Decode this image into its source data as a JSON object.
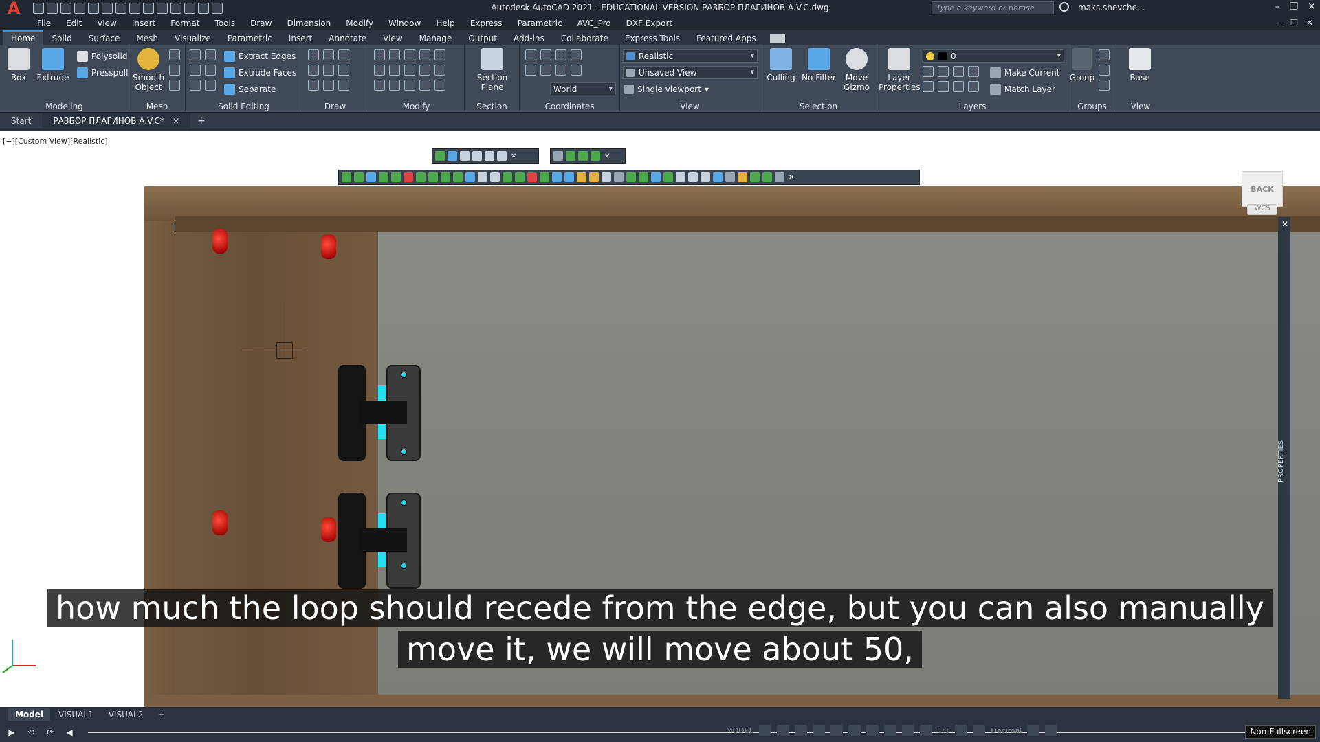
{
  "titlebar": {
    "title": "Autodesk AutoCAD 2021 - EDUCATIONAL VERSION    РАЗБОР ПЛАГИНОВ A.V.C.dwg",
    "search_placeholder": "Type a keyword or phrase",
    "user": "maks.shevche..."
  },
  "menubar": [
    "File",
    "Edit",
    "View",
    "Insert",
    "Format",
    "Tools",
    "Draw",
    "Dimension",
    "Modify",
    "Window",
    "Help",
    "Express",
    "Parametric",
    "AVC_Pro",
    "DXF Export"
  ],
  "ribbon_tabs": [
    "Home",
    "Solid",
    "Surface",
    "Mesh",
    "Visualize",
    "Parametric",
    "Insert",
    "Annotate",
    "View",
    "Manage",
    "Output",
    "Add-ins",
    "Collaborate",
    "Express Tools",
    "Featured Apps"
  ],
  "ribbon": {
    "modeling": {
      "title": "Modeling",
      "box": "Box",
      "extrude": "Extrude",
      "polysolid": "Polysolid",
      "presspull": "Presspull"
    },
    "mesh": {
      "title": "Mesh",
      "smooth_object": "Smooth Object"
    },
    "solid_editing": {
      "title": "Solid Editing",
      "extract_edges": "Extract Edges",
      "extrude_faces": "Extrude Faces",
      "separate": "Separate"
    },
    "draw": {
      "title": "Draw"
    },
    "modify": {
      "title": "Modify"
    },
    "section": {
      "title": "Section",
      "section_plane": "Section Plane"
    },
    "coordinates": {
      "title": "Coordinates",
      "world": "World"
    },
    "view": {
      "title": "View",
      "visual_style": "Realistic",
      "named_view": "Unsaved View",
      "viewport": "Single viewport"
    },
    "selection": {
      "title": "Selection",
      "culling": "Culling",
      "no_filter": "No Filter",
      "move_gizmo": "Move Gizmo"
    },
    "layers": {
      "title": "Layers",
      "layer_properties": "Layer Properties",
      "layer_value": "0",
      "make_current": "Make Current",
      "match_layer": "Match Layer"
    },
    "groups": {
      "title": "Groups",
      "group": "Group"
    },
    "view2": {
      "title": "View",
      "base": "Base"
    }
  },
  "file_tabs": {
    "start": "Start",
    "doc": "РАЗБОР ПЛАГИНОВ A.V.C*"
  },
  "viewport": {
    "label": "[−][Custom View][Realistic]",
    "viewcube": "BACK",
    "wcs": "WCS",
    "properties": "PROPERTIES"
  },
  "subtitles": [
    "how much the loop should recede from the edge, but you can also manually",
    "move it, we will move about 50,"
  ],
  "layout_tabs": [
    "Model",
    "VISUAL1",
    "VISUAL2"
  ],
  "status": {
    "model": "MODEL",
    "units": "Decimal",
    "scale": "1:1",
    "nonfullscreen": "Non-Fullscreen"
  },
  "colors": {
    "accent": "#3a94d8",
    "logo": "#e23d2d",
    "dowel": "#d41a12",
    "hinge_cyan": "#22e0f0"
  }
}
